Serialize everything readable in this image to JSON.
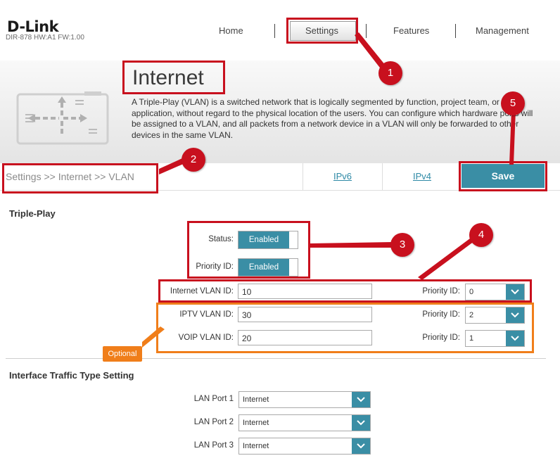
{
  "header": {
    "brand": "D-Link",
    "model": "DIR-878 HW:A1 FW:1.00",
    "nav": [
      "Home",
      "Settings",
      "Features",
      "Management"
    ]
  },
  "banner": {
    "title": "Internet",
    "description": "A Triple-Play (VLAN) is a switched network that is logically segmented by function, project team, or application, without regard to the physical location of the users. You can configure which hardware ports will be assigned to a VLAN, and all packets from a network device in a VLAN will only be forwarded to other devices in the same VLAN."
  },
  "breadcrumb": "Settings >> Internet >> VLAN",
  "tabs": [
    "IPv6",
    "IPv4"
  ],
  "save_label": "Save",
  "triple_play": {
    "title": "Triple-Play",
    "status_label": "Status:",
    "status_value": "Enabled",
    "priority_label": "Priority ID:",
    "priority_value": "Enabled",
    "rows": [
      {
        "label": "Internet VLAN ID:",
        "vlan": "10",
        "prio_label": "Priority ID:",
        "prio": "0"
      },
      {
        "label": "IPTV VLAN ID:",
        "vlan": "30",
        "prio_label": "Priority ID:",
        "prio": "2"
      },
      {
        "label": "VOIP VLAN ID:",
        "vlan": "20",
        "prio_label": "Priority ID:",
        "prio": "1"
      }
    ]
  },
  "interface": {
    "title": "Interface Traffic Type Setting",
    "ports": [
      {
        "label": "LAN Port 1",
        "value": "Internet"
      },
      {
        "label": "LAN Port 2",
        "value": "Internet"
      },
      {
        "label": "LAN Port 3",
        "value": "Internet"
      }
    ]
  },
  "annotations": {
    "badges": [
      "1",
      "2",
      "3",
      "4",
      "5"
    ],
    "optional": "Optional",
    "red": "#c8101e",
    "orange": "#f07e1a"
  },
  "colors": {
    "accent": "#3a8ea5"
  }
}
